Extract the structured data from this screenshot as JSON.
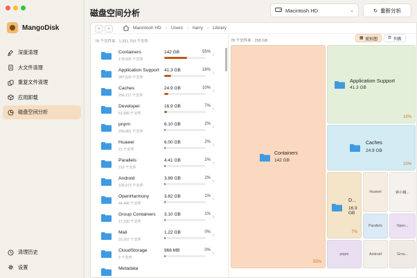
{
  "app": {
    "name": "MangoDisk",
    "traffic_colors": [
      "#ff5f57",
      "#febc2e",
      "#28c840"
    ]
  },
  "sidebar": {
    "items": [
      {
        "label": "深度清理",
        "icon": "broom-icon"
      },
      {
        "label": "大文件清理",
        "icon": "document-icon"
      },
      {
        "label": "重复文件清理",
        "icon": "duplicate-icon"
      },
      {
        "label": "应用卸载",
        "icon": "app-box-icon"
      },
      {
        "label": "磁盘空间分析",
        "icon": "pie-chart-icon",
        "active": true
      }
    ],
    "bottom": [
      {
        "label": "清理历史",
        "icon": "history-icon"
      },
      {
        "label": "设置",
        "icon": "gear-icon"
      }
    ]
  },
  "header": {
    "title": "磁盘空间分析",
    "disk": "Macintosh HD",
    "rescan_label": "重新分析"
  },
  "breadcrumb": [
    "Macintosh HD",
    "Users",
    "harry",
    "Library"
  ],
  "list": {
    "summary": "78 个文件夹 · 1,321,793 个文件",
    "items": [
      {
        "name": "Containers",
        "count": "178,925 个文件",
        "size": "142 GB",
        "pct": "55%",
        "ratio": 0.55
      },
      {
        "name": "Application Support",
        "count": "287,529 个文件",
        "size": "41.3 GB",
        "pct": "16%",
        "ratio": 0.16
      },
      {
        "name": "Caches",
        "count": "256,117 个文件",
        "size": "24.9 GB",
        "pct": "10%",
        "ratio": 0.1
      },
      {
        "name": "Developer",
        "count": "51,680 个文件",
        "size": "16.9 GB",
        "pct": "7%",
        "ratio": 0.07
      },
      {
        "name": "pnpm",
        "count": "290,861 个文件",
        "size": "6.10 GB",
        "pct": "2%",
        "ratio": 0.024
      },
      {
        "name": "Huawei",
        "count": "21 个文件",
        "size": "6.00 GB",
        "pct": "2%",
        "ratio": 0.023
      },
      {
        "name": "Parallels",
        "count": "210 个文件",
        "size": "4.41 GB",
        "pct": "2%",
        "ratio": 0.017
      },
      {
        "name": "Android",
        "count": "103,072 个文件",
        "size": "3.89 GB",
        "pct": "2%",
        "ratio": 0.015
      },
      {
        "name": "OpenHarmony",
        "count": "44,440 个文件",
        "size": "3.82 GB",
        "pct": "1%",
        "ratio": 0.015
      },
      {
        "name": "Group Containers",
        "count": "17,230 个文件",
        "size": "3.10 GB",
        "pct": "1%",
        "ratio": 0.012
      },
      {
        "name": "Mail",
        "count": "31,207 个文件",
        "size": "1.22 GB",
        "pct": "0%",
        "ratio": 0.005
      },
      {
        "name": "CloudStorage",
        "count": "9 个文件",
        "size": "968 MB",
        "pct": "0%",
        "ratio": 0.004
      },
      {
        "name": "Metadata",
        "count": "",
        "size": "",
        "pct": "",
        "ratio": 0
      }
    ]
  },
  "treemap": {
    "summary": "78 个文件夹 · 258 GB",
    "view_treemap": "矩形图",
    "view_list": "列表",
    "tiles": {
      "containers": {
        "name": "Containers",
        "size": "142 GB",
        "pct": "55%"
      },
      "appsupport": {
        "name": "Application Support",
        "size": "41.3 GB",
        "pct": "16%"
      },
      "caches": {
        "name": "Caches",
        "size": "24.9 GB",
        "pct": "10%"
      },
      "developer": {
        "name": "D...",
        "size": "16.9 GB",
        "pct": "7%"
      },
      "huawei": "Huawei",
      "small1": "钟小猪...",
      "parallels": "Parallels",
      "open": "Open...",
      "pnpm": "pnpm",
      "android": "Android",
      "group": "Grou..."
    }
  }
}
